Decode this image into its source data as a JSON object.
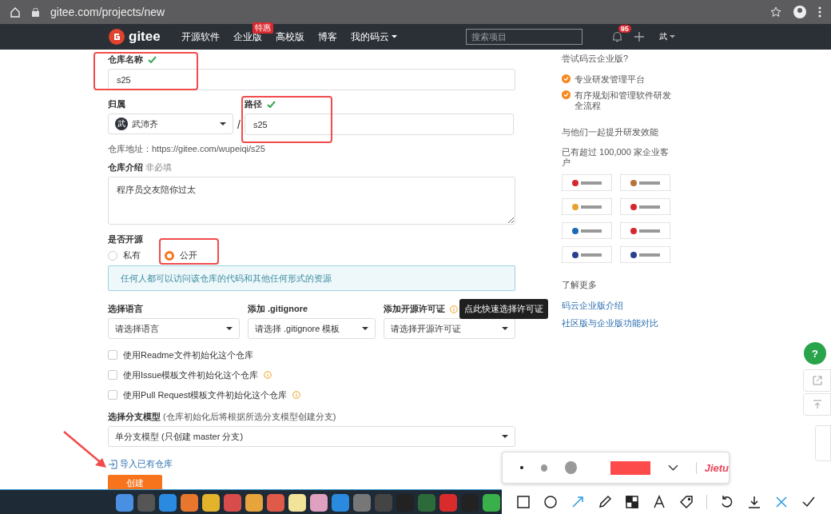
{
  "browser": {
    "url": "gitee.com/projects/new"
  },
  "nav": {
    "logo": "gitee",
    "items": [
      {
        "label": "开源软件"
      },
      {
        "label": "企业版",
        "badge": "特惠"
      },
      {
        "label": "高校版"
      },
      {
        "label": "博客"
      },
      {
        "label": "我的码云",
        "dropdown": true
      }
    ],
    "search_placeholder": "搜索项目",
    "notifications": "95",
    "user": "武"
  },
  "form": {
    "name": {
      "label": "仓库名称",
      "valid": true,
      "value": "s25"
    },
    "owner": {
      "label": "归属",
      "avatar": "武",
      "value": "武沛齐"
    },
    "separator": "/",
    "path": {
      "label": "路径",
      "valid": true,
      "value": "s25"
    },
    "address": "仓库地址：https://gitee.com/wupeiqi/s25",
    "description": {
      "label": "仓库介绍",
      "hint": "非必填",
      "value": "程序员交友陪你过太"
    },
    "visibility": {
      "label": "是否开源",
      "options": [
        {
          "label": "私有",
          "selected": false
        },
        {
          "label": "公开",
          "selected": true
        }
      ],
      "notice": "任何人都可以访问该仓库的代码和其他任何形式的资源"
    },
    "selects": [
      {
        "label": "选择语言",
        "value": "请选择语言",
        "info": false
      },
      {
        "label": "添加 .gitignore",
        "value": "请选择 .gitignore 模板",
        "info": false
      },
      {
        "label": "添加开源许可证",
        "value": "请选择开源许可证",
        "info": true
      }
    ],
    "tooltip": "点此快速选择许可证",
    "checkboxes": [
      {
        "label": "使用Readme文件初始化这个仓库",
        "checked": false,
        "info": false
      },
      {
        "label": "使用Issue模板文件初始化这个仓库",
        "checked": false,
        "info": true
      },
      {
        "label": "使用Pull Request模板文件初始化这个仓库",
        "checked": false,
        "info": true
      }
    ],
    "branch": {
      "label": "选择分支模型",
      "hint": "(仓库初始化后将根据所选分支模型创建分支)",
      "value": "单分支模型 (只创建 master 分支)"
    },
    "import_link": "导入已有仓库",
    "submit": "创建"
  },
  "sidebar": {
    "title": "尝试码云企业版?",
    "features": [
      "专业研发管理平台",
      "有序规划和管理软件研发全流程"
    ],
    "heading": "与他们一起提升研发效能",
    "customers": "已有超过 100,000 家企业客户",
    "more_title": "了解更多",
    "links": [
      "码云企业版介绍",
      "社区版与企业版功能对比"
    ]
  },
  "help": "?",
  "screenshot_tool": {
    "sizes": [
      {
        "kind": "small",
        "selected": true
      },
      {
        "kind": "medium",
        "selected": false
      },
      {
        "kind": "large",
        "selected": false
      }
    ],
    "color": "#fd4a4a",
    "brand": "Jietu",
    "tools": [
      {
        "kind": "rectangle",
        "selected": false
      },
      {
        "kind": "ellipse",
        "selected": false
      },
      {
        "kind": "arrow",
        "selected": true
      },
      {
        "kind": "pen",
        "selected": false
      },
      {
        "kind": "mosaic",
        "selected": false
      },
      {
        "kind": "text",
        "selected": false
      },
      {
        "kind": "tag",
        "selected": false
      }
    ],
    "actions": [
      {
        "kind": "undo"
      },
      {
        "kind": "save"
      },
      {
        "kind": "cancel"
      },
      {
        "kind": "confirm"
      }
    ]
  }
}
